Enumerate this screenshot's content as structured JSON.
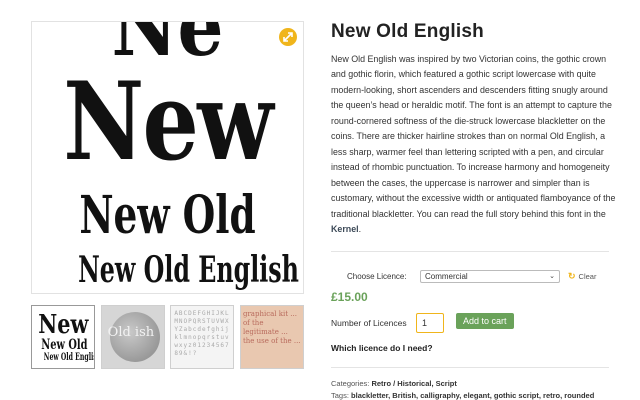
{
  "product": {
    "title": "New Old English",
    "description_before_link": "New Old English was inspired by two Victorian coins, the gothic crown and gothic florin, which featured a gothic script lowercase with quite modern-looking, short ascenders and descenders fitting snugly around the queen’s head or heraldic motif. The font is an attempt to capture the round-cornered softness of the die-struck lowercase blackletter on the coins. There are thicker hairline strokes than on normal Old English, a less sharp, warmer feel than lettering scripted with a pen, and circular instead of rhombic punctuation. To increase harmony and homogeneity between the cases, the uppercase is narrower and simpler than is customary, without the excessive width or antiquated flamboyance of the traditional blackletter. You can read the full story behind this font in the ",
    "description_link": "Kernel",
    "description_after_link": ".",
    "price": "£15.00"
  },
  "gallery": {
    "main_sample": {
      "line1": "Ne",
      "line2": "New",
      "line3": "New Old",
      "line4": "New Old English"
    },
    "thumb1": {
      "a": "New",
      "b": "New Old",
      "c": "New Old English"
    },
    "thumb2": {
      "text": "Old ish"
    },
    "thumb3": {
      "text": "ABCDEFGHIJKLMNOPQRSTUVWXYZabcdefghijklmnopqrstuvwxyz0123456789&!?"
    },
    "thumb4": {
      "text": "graphical kit ... of the legitimate ... the use of the ..."
    }
  },
  "licence": {
    "label": "Choose Licence:",
    "selected": "Commercial",
    "clear": "Clear"
  },
  "quantity": {
    "label": "Number of Licences",
    "value": "1",
    "add_button": "Add to cart"
  },
  "which_licence": "Which licence do I need?",
  "categories": {
    "label": "Categories:",
    "items": "Retro / Historical, Script"
  },
  "tags": {
    "label": "Tags:",
    "items": "blackletter, British, calligraphy, elegant, gothic script, retro, rounded"
  },
  "colors": {
    "accent": "#f0b51b",
    "price_green": "#6aa25a",
    "button_green": "#6aa25a"
  }
}
